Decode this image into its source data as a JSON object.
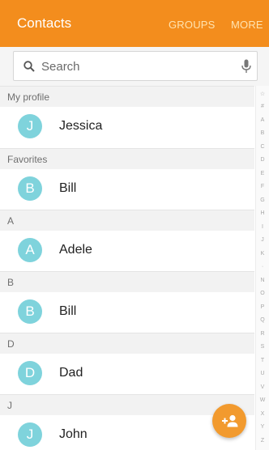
{
  "appbar": {
    "title": "Contacts",
    "actions": [
      "GROUPS",
      "MORE"
    ],
    "color": "#f38d1d"
  },
  "search": {
    "placeholder": "Search",
    "search_icon": "search-icon",
    "mic_icon": "microphone-icon"
  },
  "sections": [
    {
      "header": "My profile",
      "contacts": [
        {
          "initial": "J",
          "name": "Jessica"
        }
      ]
    },
    {
      "header": "Favorites",
      "contacts": [
        {
          "initial": "B",
          "name": "Bill"
        }
      ]
    },
    {
      "header": "A",
      "contacts": [
        {
          "initial": "A",
          "name": "Adele"
        }
      ]
    },
    {
      "header": "B",
      "contacts": [
        {
          "initial": "B",
          "name": "Bill"
        }
      ]
    },
    {
      "header": "D",
      "contacts": [
        {
          "initial": "D",
          "name": "Dad"
        }
      ]
    },
    {
      "header": "J",
      "contacts": [
        {
          "initial": "J",
          "name": "John"
        }
      ]
    }
  ],
  "index_letters": [
    "☆",
    "#",
    "A",
    "B",
    "C",
    "D",
    "E",
    "F",
    "G",
    "H",
    "I",
    "J",
    "K",
    "·",
    "N",
    "O",
    "P",
    "Q",
    "R",
    "S",
    "T",
    "U",
    "V",
    "W",
    "X",
    "Y",
    "Z"
  ],
  "fab": {
    "icon": "add-contact-icon",
    "color": "#f29a2e"
  },
  "avatar_color": "#7fd3dc"
}
